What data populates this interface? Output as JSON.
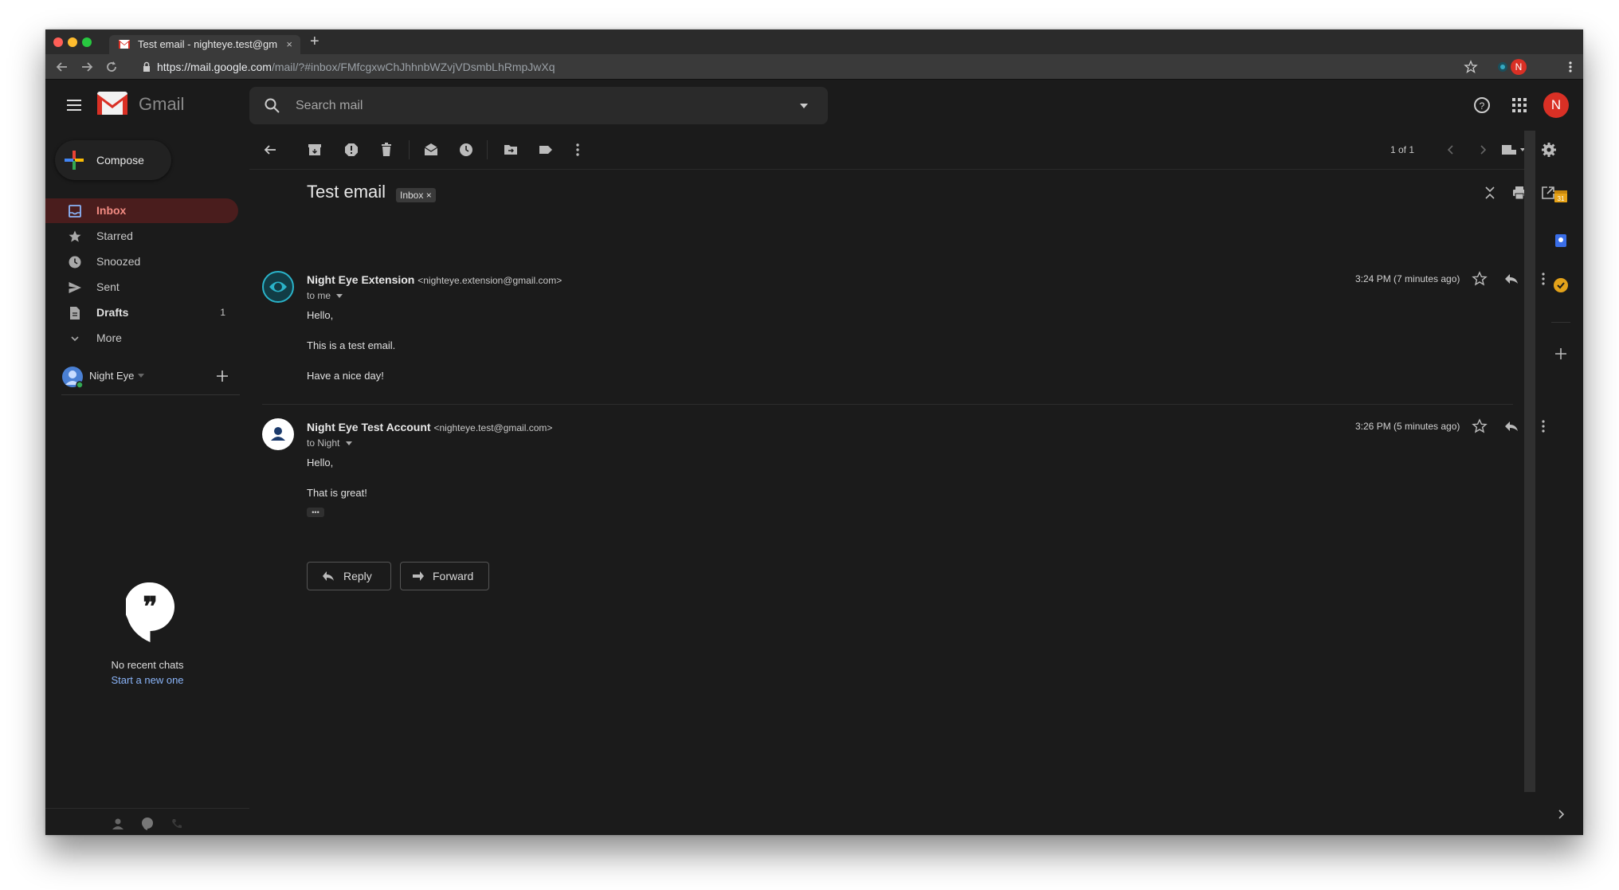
{
  "browser": {
    "tab_title": "Test email - nighteye.test@gm",
    "tab_close": "×",
    "new_tab": "+",
    "url_host": "https://mail.google.com",
    "url_path": "/mail/?#inbox/FMfcgxwChJhhnbWZvjVDsmbLhRmpJwXq",
    "profile_initial": "N"
  },
  "gmail": {
    "logo_text": "Gmail",
    "search_placeholder": "Search mail",
    "account_initial": "N"
  },
  "sidebar": {
    "compose_label": "Compose",
    "items": [
      {
        "label": "Inbox",
        "count": "",
        "icon": "inbox-icon",
        "active": true
      },
      {
        "label": "Starred",
        "count": "",
        "icon": "star-icon",
        "active": false
      },
      {
        "label": "Snoozed",
        "count": "",
        "icon": "clock-icon",
        "active": false
      },
      {
        "label": "Sent",
        "count": "",
        "icon": "send-icon",
        "active": false
      },
      {
        "label": "Drafts",
        "count": "1",
        "icon": "draft-icon",
        "active": false
      },
      {
        "label": "More",
        "count": "",
        "icon": "chevron-down-icon",
        "active": false
      }
    ],
    "hangouts_user": "Night Eye",
    "no_chats": "No recent chats",
    "start_new": "Start a new one"
  },
  "toolbar": {
    "pagination": "1 of 1"
  },
  "thread": {
    "subject": "Test email",
    "label_badge": "Inbox",
    "label_badge_close": "×",
    "messages": [
      {
        "sender_name": "Night Eye Extension",
        "sender_email": "<nighteye.extension@gmail.com>",
        "to": "to me",
        "time": "3:24 PM (7 minutes ago)",
        "lines": [
          "Hello,",
          "This is a test email.",
          "Have a nice day!"
        ]
      },
      {
        "sender_name": "Night Eye Test Account",
        "sender_email": "<nighteye.test@gmail.com>",
        "to": "to Night",
        "time": "3:26 PM (5 minutes ago)",
        "lines": [
          "Hello,",
          "That is great!"
        ]
      }
    ],
    "reply_label": "Reply",
    "forward_label": "Forward",
    "ellipsis": "•••"
  },
  "colors": {
    "accent_red": "#d93025",
    "active_bg": "#4a1d1d",
    "active_text": "#f28b82",
    "link_blue": "#8ab4f8"
  }
}
